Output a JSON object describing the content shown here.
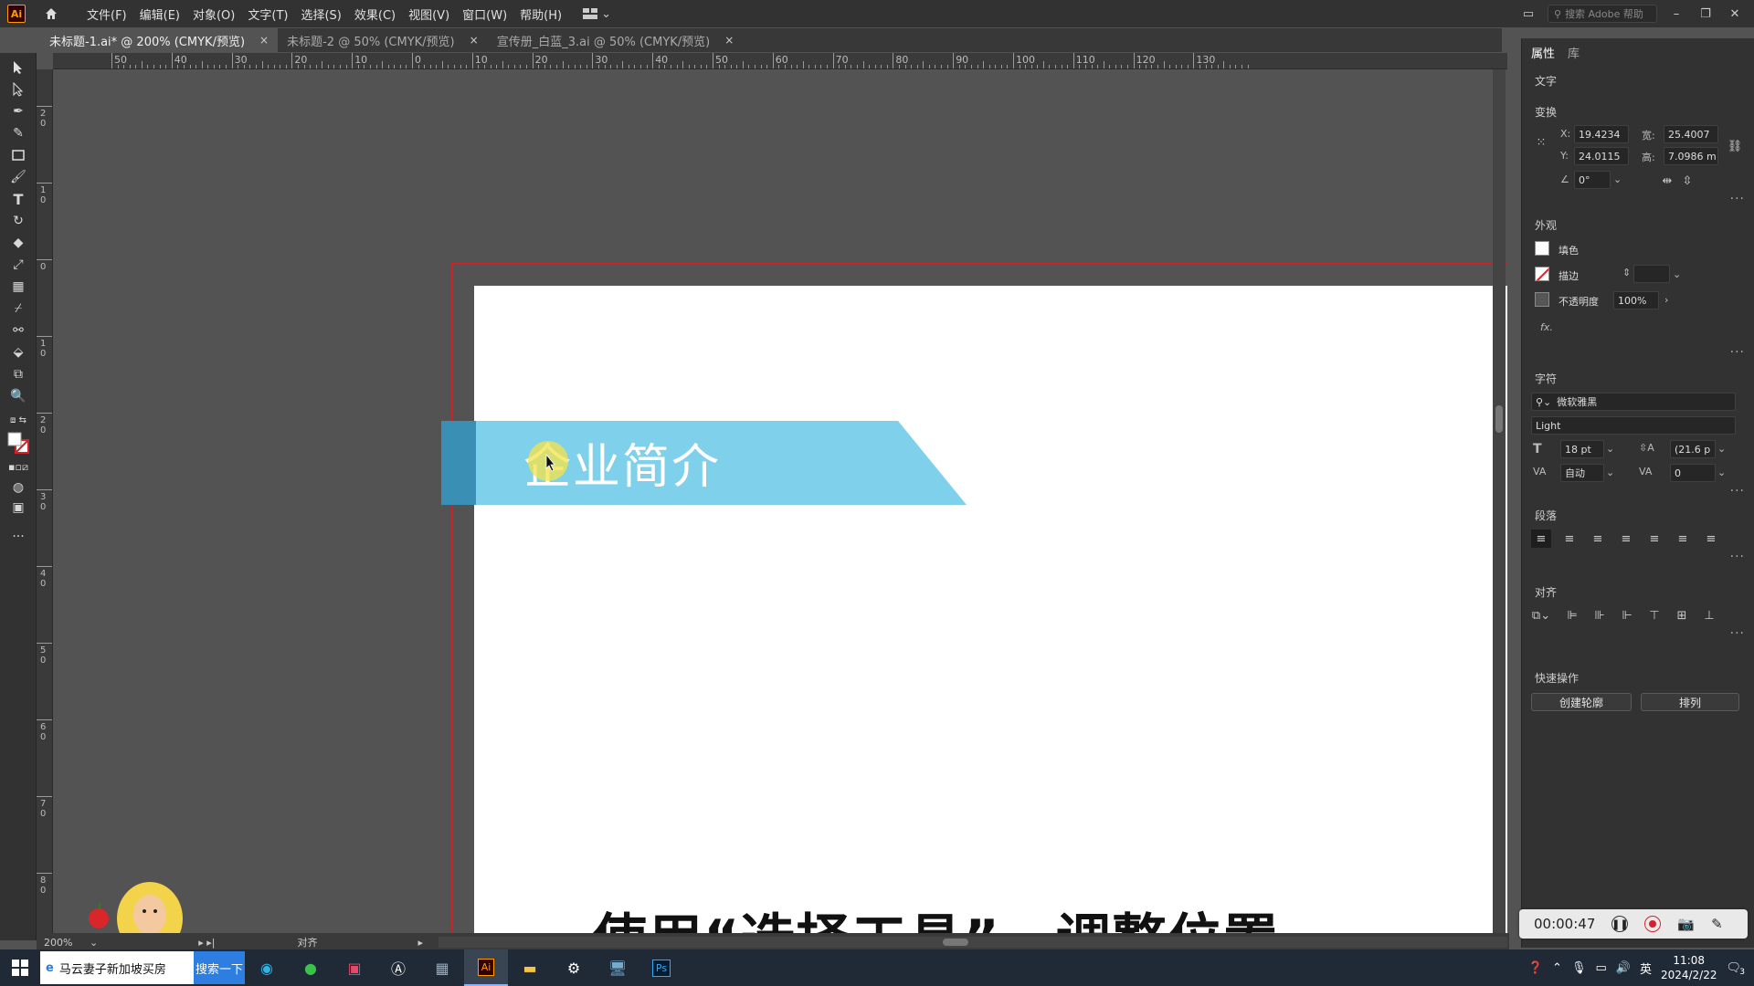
{
  "app": {
    "logo": "Ai"
  },
  "menu": [
    "文件(F)",
    "编辑(E)",
    "对象(O)",
    "文字(T)",
    "选择(S)",
    "效果(C)",
    "视图(V)",
    "窗口(W)",
    "帮助(H)"
  ],
  "search": {
    "placeholder": "搜索 Adobe 帮助"
  },
  "tabs": [
    {
      "label": "未标题-1.ai* @ 200% (CMYK/预览)",
      "active": true
    },
    {
      "label": "未标题-2 @ 50% (CMYK/预览)",
      "active": false
    },
    {
      "label": "宣传册_白蓝_3.ai @ 50% (CMYK/预览)",
      "active": false
    }
  ],
  "ruler_top": [
    "50",
    "40",
    "30",
    "20",
    "10",
    "0",
    "10",
    "20",
    "30",
    "40",
    "50",
    "60",
    "70",
    "80",
    "90",
    "100",
    "110",
    "120",
    "130"
  ],
  "ruler_left": [
    "2\n0",
    "1\n0",
    "0",
    "1\n0",
    "2\n0",
    "3\n0",
    "4\n0",
    "5\n0",
    "6\n0",
    "7\n0",
    "8\n0"
  ],
  "canvas": {
    "banner_title": "企业简介",
    "subtitle": "使用“选择工具”，调整位置",
    "banner_color": "#7fd0ea",
    "banner_dark": "#3a8fb5"
  },
  "status": {
    "zoom": "200%",
    "label": "对齐"
  },
  "panel": {
    "tabs": [
      "属性",
      "库"
    ],
    "type_label": "文字",
    "transform": {
      "title": "变换",
      "x_label": "X:",
      "x": "19.4234",
      "y_label": "Y:",
      "y": "24.0115",
      "w_label": "宽:",
      "w": "25.4007",
      "h_label": "高:",
      "h": "7.0986 m",
      "angle": "0°"
    },
    "appearance": {
      "title": "外观",
      "fill": "填色",
      "stroke": "描边",
      "opacity_label": "不透明度",
      "opacity": "100%",
      "fx": "fx."
    },
    "character": {
      "title": "字符",
      "font": "微软雅黑",
      "style": "Light",
      "size": "18 pt",
      "leading": "(21.6 p",
      "tracking_mode": "自动",
      "kerning": "0"
    },
    "paragraph": {
      "title": "段落"
    },
    "align": {
      "title": "对齐"
    },
    "quick": {
      "title": "快速操作",
      "btn1": "创建轮廓",
      "btn2": "排列"
    }
  },
  "recorder": {
    "time": "00:00:47"
  },
  "taskbar": {
    "search_text": "马云妻子新加坡买房",
    "search_btn": "搜索一下",
    "ime": "英",
    "time": "11:08",
    "date": "2024/2/22",
    "notif": "3"
  }
}
